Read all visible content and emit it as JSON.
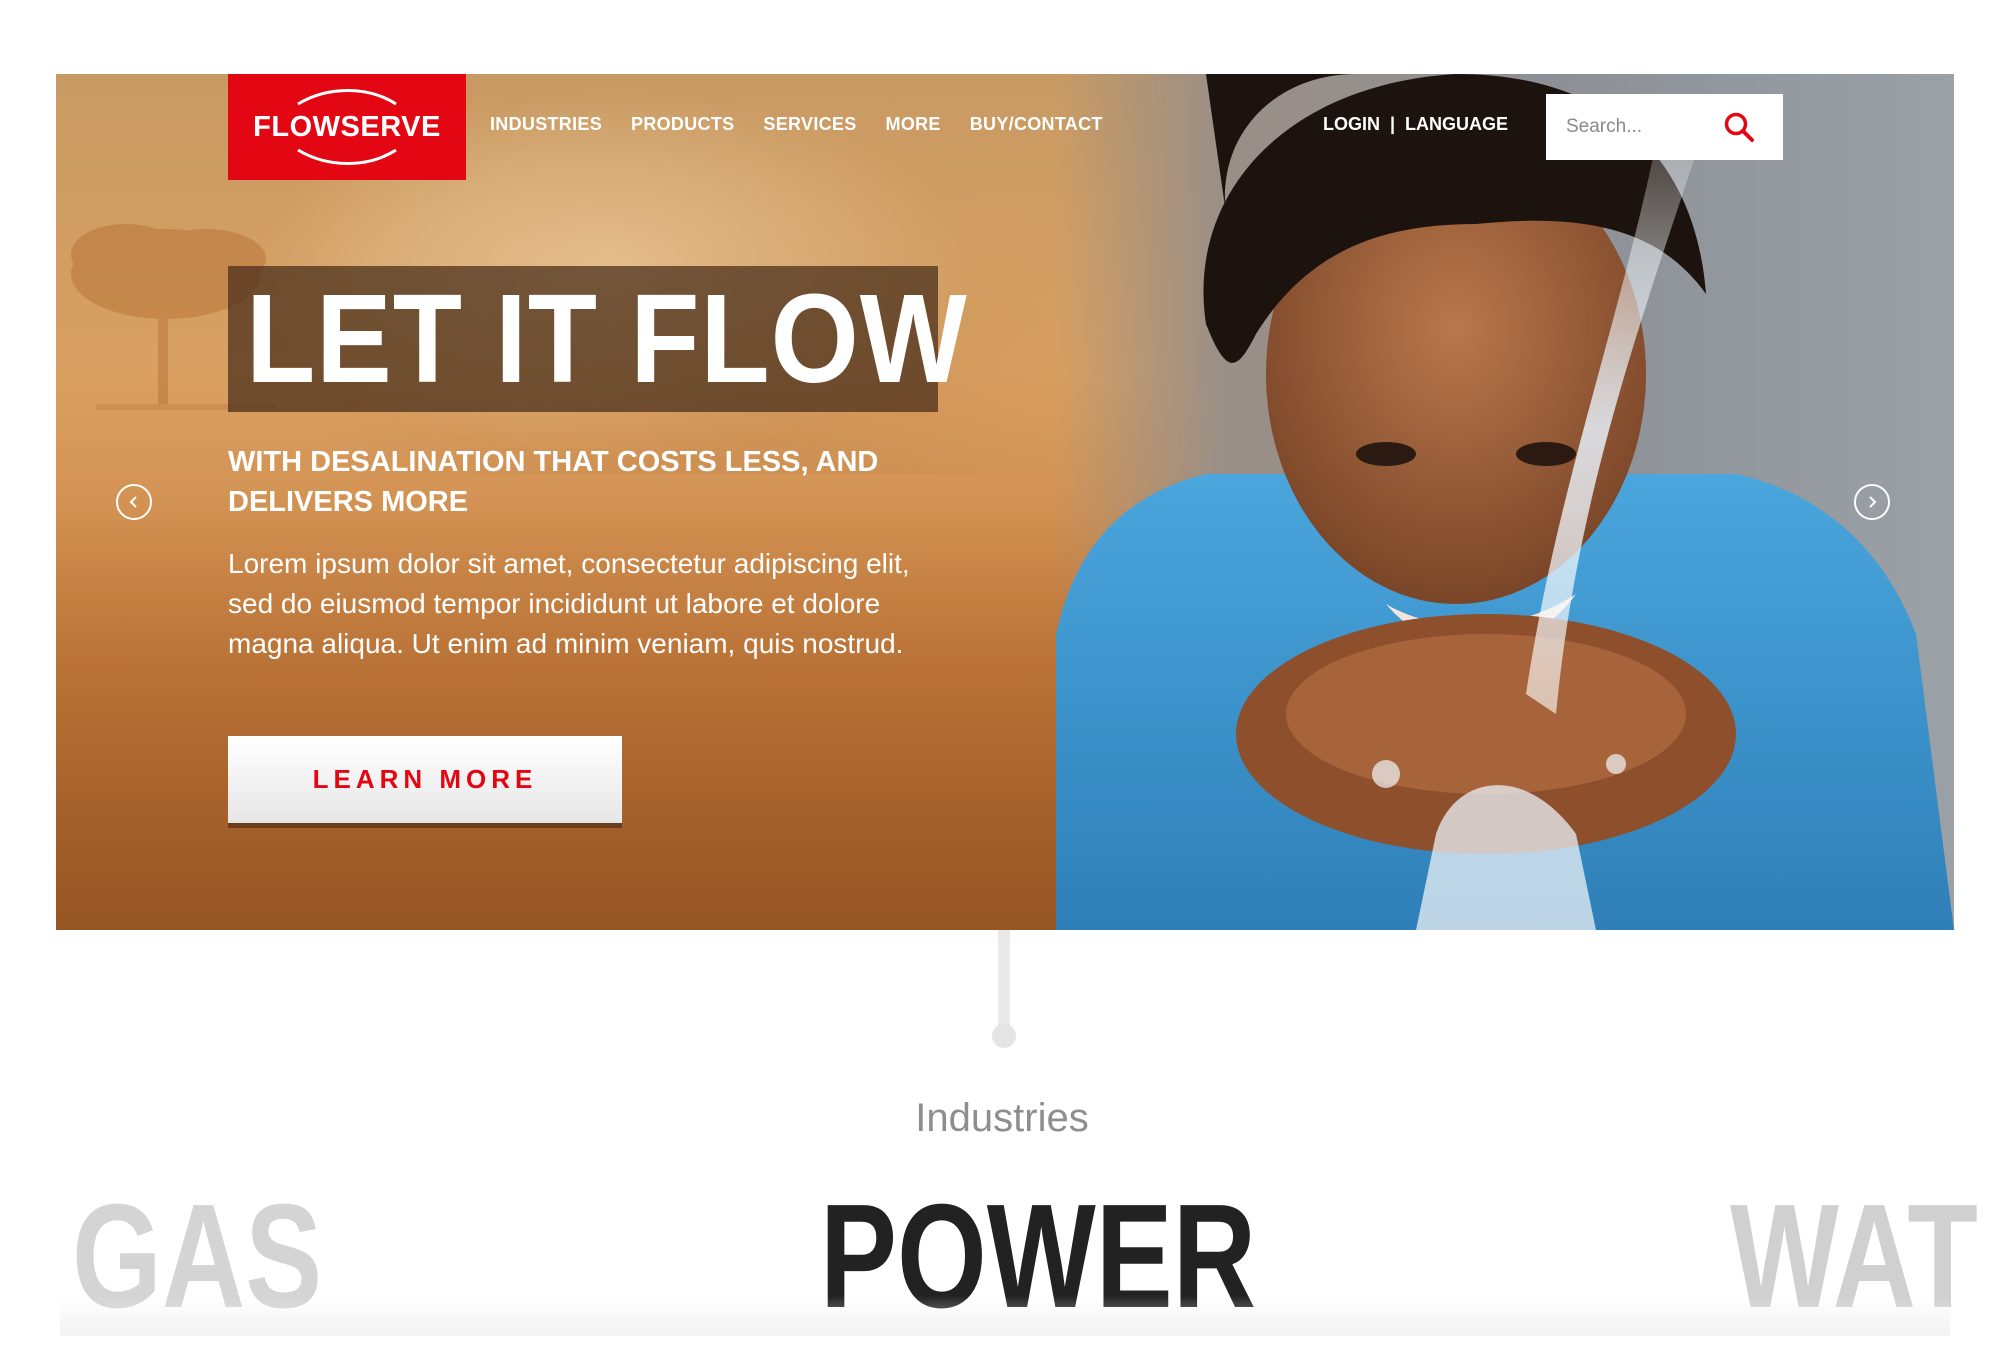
{
  "brand": {
    "name": "FLOWSERVE",
    "accent": "#e30613"
  },
  "nav": {
    "items": [
      "INDUSTRIES",
      "PRODUCTS",
      "SERVICES",
      "MORE",
      "BUY/CONTACT"
    ],
    "login": "LOGIN",
    "separator": "|",
    "language": "LANGUAGE"
  },
  "search": {
    "placeholder": "Search..."
  },
  "hero": {
    "headline": "LET IT FLOW",
    "subhead": "WITH DESALINATION THAT COSTS LESS, AND DELIVERS MORE",
    "body": "Lorem ipsum dolor sit amet, consectetur adipiscing elit, sed do eiusmod tempor incididunt ut labore et dolore magna aliqua. Ut enim ad minim veniam, quis nostrud.",
    "cta": "LEARN MORE"
  },
  "icons": {
    "prev": "chevron-left-circle-icon",
    "next": "chevron-right-circle-icon",
    "search": "search-icon"
  },
  "industries": {
    "label": "Industries",
    "prev": "GAS",
    "current": "POWER",
    "next": "WAT"
  }
}
